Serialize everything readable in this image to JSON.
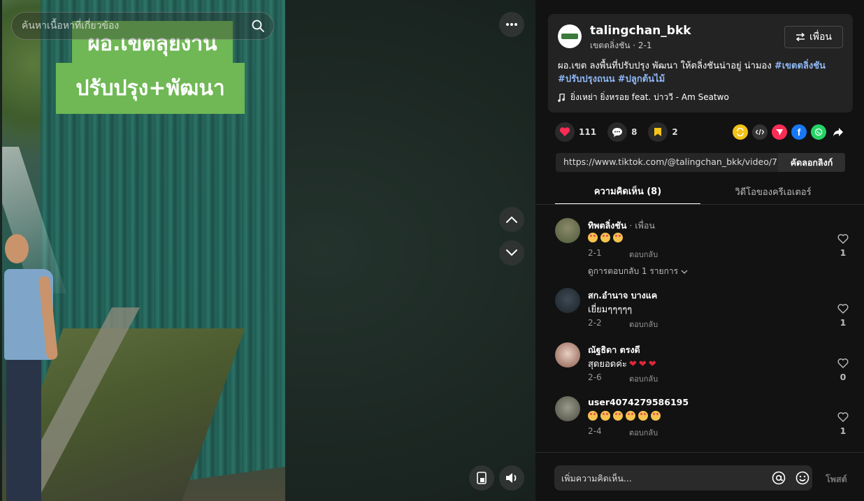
{
  "video": {
    "search_placeholder": "ค้นหาเนื้อหาที่เกี่ยวข้อง",
    "sign_line1": "ผอ.เขตลุยงาน",
    "sign_line2": "ปรับปรุง+พัฒนา",
    "icons": [
      "search-icon",
      "more-icon",
      "chevron-up-icon",
      "chevron-down-icon",
      "pip-icon",
      "volume-icon"
    ]
  },
  "post": {
    "username": "talingchan_bkk",
    "subtitle": "เขตตลิ่งชัน · 2-1",
    "friend_button": "เพื่อน",
    "caption_text": "ผอ.เขต ลงพื้นที่ปรับปรุง พัฒนา ให้ตลิ่งชันน่าอยู่ น่ามอง ",
    "hashtags": [
      "#เขตตลิ่งชัน",
      "#ปรับปรุงถนน",
      "#ปลูกต้นไม้"
    ],
    "music": "ยิ่งเหย่า ยิ่งหรอย feat. บ่าววี - Am Seatwo"
  },
  "actions": {
    "likes": "111",
    "comments": "8",
    "saves": "2",
    "share_icons": [
      "repost-icon",
      "embed-icon",
      "send-icon",
      "facebook-icon",
      "whatsapp-icon",
      "share-arrow-icon"
    ],
    "colors": {
      "like": "#fe2c55",
      "save": "#f5c518",
      "repost": "#f2c218",
      "send": "#fe2c55",
      "facebook": "#1877f2",
      "whatsapp": "#25d366"
    }
  },
  "link": {
    "url": "https://www.tiktok.com/@talingchan_bkk/video/746...",
    "copy_label": "คัดลอกลิงก์"
  },
  "tabs": {
    "comments_label": "ความคิดเห็น (8)",
    "creator_label": "วิดีโอของครีเอเตอร์"
  },
  "comments": [
    {
      "name": "ทิพตลิ่งชัน",
      "friend_tag": " · เพื่อน",
      "emoji_count": 3,
      "text": "",
      "date": "2-1",
      "reply": "ตอบกลับ",
      "likes": "1",
      "view_replies": "ดูการตอบกลับ 1 รายการ"
    },
    {
      "name": "สก.อำนาจ บางแค",
      "friend_tag": "",
      "emoji_count": 0,
      "text": "เยี่ยมๆๆๆๆๆ",
      "date": "2-2",
      "reply": "ตอบกลับ",
      "likes": "1"
    },
    {
      "name": "ณัฐธิดา ตรงดี",
      "friend_tag": "",
      "emoji_count": 0,
      "text": "สุดยอดค่ะ",
      "date": "2-6",
      "reply": "ตอบกลับ",
      "likes": "0"
    },
    {
      "name": "user4074279586195",
      "friend_tag": "",
      "emoji_count": 6,
      "text": "",
      "date": "2-4",
      "reply": "ตอบกลับ",
      "likes": "1"
    }
  ],
  "comment_input": {
    "placeholder": "เพิ่มความคิดเห็น...",
    "post_label": "โพสต์"
  }
}
